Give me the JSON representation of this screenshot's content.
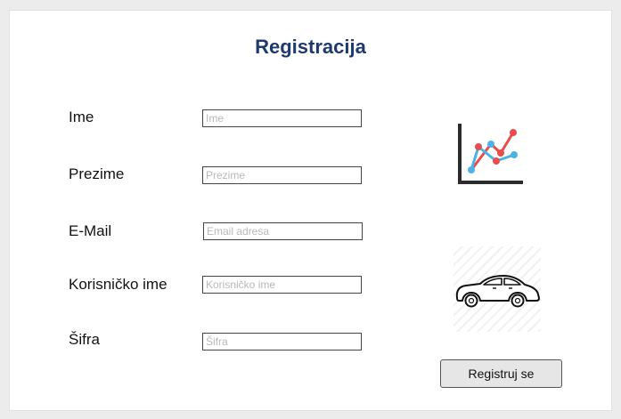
{
  "form": {
    "title": "Registracija",
    "fields": [
      {
        "label": "Ime",
        "placeholder": "Ime",
        "value": ""
      },
      {
        "label": "Prezime",
        "placeholder": "Prezime",
        "value": ""
      },
      {
        "label": "E-Mail",
        "placeholder": "Email adresa",
        "value": ""
      },
      {
        "label": "Korisničko ime",
        "placeholder": "Korisničko ime",
        "value": ""
      },
      {
        "label": "Šifra",
        "placeholder": "Šifra",
        "value": ""
      }
    ],
    "submit_label": "Registruj se"
  },
  "icons": {
    "chart": "line-chart-icon",
    "car": "car-icon"
  },
  "colors": {
    "title": "#1f3a6e",
    "chart_blue": "#4ab3e8",
    "chart_red": "#e84c4c",
    "chart_axis": "#2b2b2b"
  }
}
